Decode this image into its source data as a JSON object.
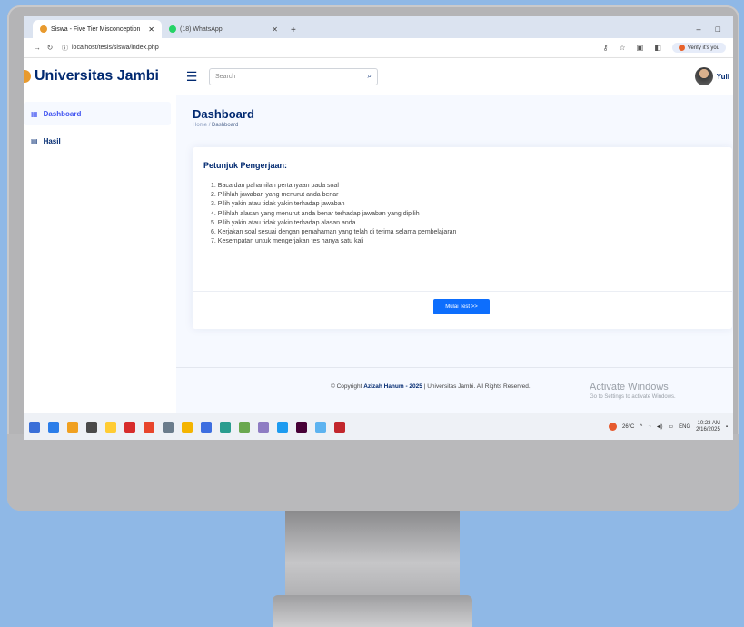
{
  "browser": {
    "tabs": [
      {
        "label": "Siswa - Five Tier Misconception",
        "active": true,
        "favicon_color": "#e89a2e"
      },
      {
        "label": "(18) WhatsApp",
        "active": false,
        "favicon_color": "#25d366"
      }
    ],
    "new_tab": "+",
    "url": "localhost/tesis/siswa/index.php",
    "verify_label": "Verify it's you",
    "window_controls": [
      "–",
      "□"
    ]
  },
  "header": {
    "logo_text": "Universitas Jambi",
    "search_placeholder": "Search",
    "user_name": "Yuli"
  },
  "sidebar": {
    "items": [
      {
        "label": "Dashboard",
        "icon": "grid-icon",
        "active": true
      },
      {
        "label": "Hasil",
        "icon": "document-icon",
        "active": false
      }
    ]
  },
  "main": {
    "page_title": "Dashboard",
    "breadcrumb": {
      "home": "Home",
      "separator": "/",
      "current": "Dashboard"
    },
    "card_title": "Petunjuk Pengerjaan:",
    "instructions": [
      "1. Baca dan pahamilah pertanyaan pada soal",
      "2. Pilihlah jawaban yang menurut anda benar",
      "3. Pilih yakin atau tidak yakin terhadap jawaban",
      "4. Pilihlah alasan yang menurut anda benar terhadap jawaban yang dipilih",
      "5. Pilih yakin atau tidak yakin terhadap alasan anda",
      "6. Kerjakan soal sesuai dengan pemahaman yang telah di terima selama pembelajaran",
      "7. Kesempatan untuk mengerjakan tes hanya satu kali"
    ],
    "start_button": "Mulai Test >>"
  },
  "footer": {
    "prefix": "© Copyright",
    "author": "Azizah Hanum - 2025",
    "suffix": "| Universitas Jambi. All Rights Reserved."
  },
  "watermark": {
    "line1": "Activate Windows",
    "line2": "Go to Settings to activate Windows."
  },
  "taskbar": {
    "temperature": "26°C",
    "language": "ENG",
    "time": "10:23 AM",
    "date": "2/16/2025",
    "icon_colors": [
      "#3a6fd8",
      "#2b7de9",
      "#f0a020",
      "#4a4a4a",
      "#ffcc33",
      "#d72c2c",
      "#e8452c",
      "#6b7c8c",
      "#f4b400",
      "#3d6ee0",
      "#2a9d8f",
      "#6aa84f",
      "#8e7cc3",
      "#1d9bf0",
      "#470137",
      "#5db3f0",
      "#c2272d"
    ]
  }
}
